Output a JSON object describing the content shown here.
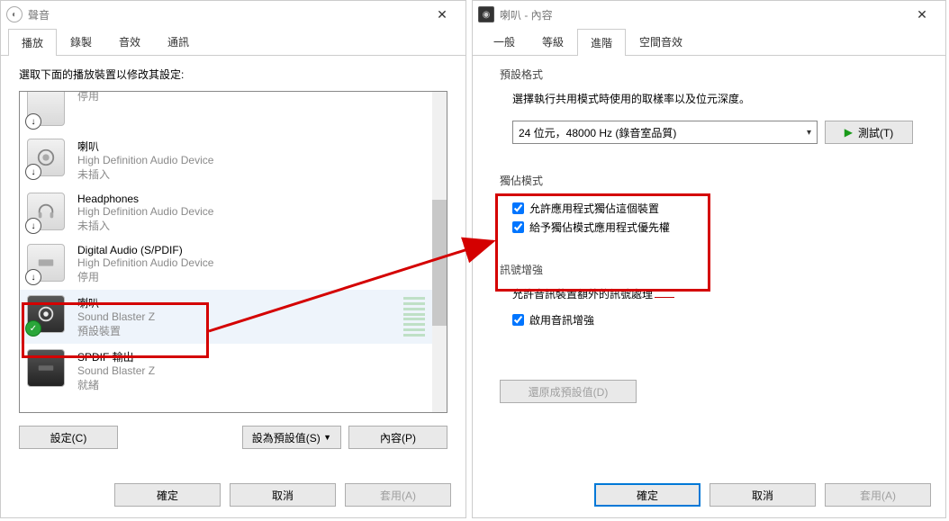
{
  "dlg1": {
    "title": "聲音",
    "tabs": [
      "播放",
      "錄製",
      "音效",
      "通訊"
    ],
    "active_tab": 0,
    "instruction": "選取下面的播放裝置以修改其設定:",
    "devices": [
      {
        "name": "",
        "device": "",
        "status": "停用",
        "badge": "arrow"
      },
      {
        "name": "喇叭",
        "device": "High Definition Audio Device",
        "status": "未插入",
        "badge": "arrow"
      },
      {
        "name": "Headphones",
        "device": "High Definition Audio Device",
        "status": "未插入",
        "badge": "arrow"
      },
      {
        "name": "Digital Audio (S/PDIF)",
        "device": "High Definition Audio Device",
        "status": "停用",
        "badge": "arrow"
      },
      {
        "name": "喇叭",
        "device": "Sound Blaster Z",
        "status": "預設裝置",
        "badge": "check",
        "selected": true
      },
      {
        "name": "SPDIF 輸出",
        "device": "Sound Blaster Z",
        "status": "就緒",
        "badge": "none"
      }
    ],
    "btn_config": "設定(C)",
    "btn_default": "設為預設值(S)",
    "btn_props": "內容(P)",
    "btn_ok": "確定",
    "btn_cancel": "取消",
    "btn_apply": "套用(A)"
  },
  "dlg2": {
    "title": "喇叭 - 內容",
    "tabs": [
      "一般",
      "等級",
      "進階",
      "空間音效"
    ],
    "active_tab": 2,
    "group_format": {
      "title": "預設格式",
      "desc": "選擇執行共用模式時使用的取樣率以及位元深度。",
      "combo": "24 位元，48000 Hz (錄音室品質)",
      "test": "測試(T)"
    },
    "group_exclusive": {
      "title": "獨佔模式",
      "cb1": "允許應用程式獨佔這個裝置",
      "cb2": "給予獨佔模式應用程式優先權"
    },
    "group_enhance": {
      "title": "訊號增強",
      "desc": "允許音訊裝置額外的訊號處理",
      "cb": "啟用音訊增強"
    },
    "btn_restore": "還原成預設值(D)",
    "btn_ok": "確定",
    "btn_cancel": "取消",
    "btn_apply": "套用(A)"
  },
  "annotation": {
    "color": "#d40000"
  }
}
